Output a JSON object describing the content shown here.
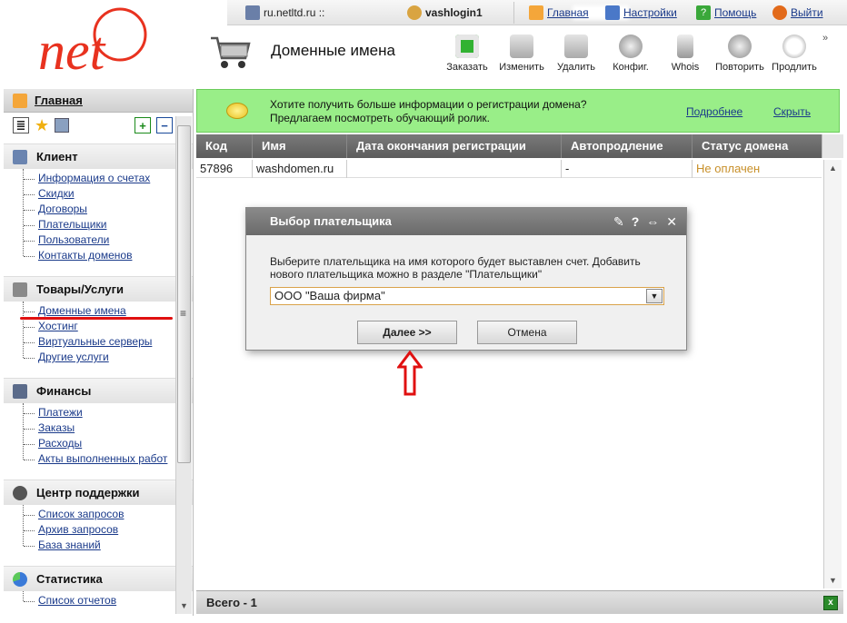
{
  "topbar": {
    "server": "ru.netltd.ru ::",
    "login": "vashlogin1",
    "home": "Главная",
    "settings": "Настройки",
    "help": "Помощь",
    "logout": "Выйти"
  },
  "header": {
    "title": "Доменные имена",
    "logo_text": "net",
    "tools": [
      "Заказать",
      "Изменить",
      "Удалить",
      "Конфиг.",
      "Whois",
      "Повторить",
      "Продлить"
    ],
    "more": "»"
  },
  "sidebar": {
    "main": "Главная",
    "sections": [
      {
        "title": "Клиент",
        "items": [
          "Информация о счетах",
          "Скидки",
          "Договоры",
          "Плательщики",
          "Пользователи",
          "Контакты доменов"
        ]
      },
      {
        "title": "Товары/Услуги",
        "items": [
          "Доменные имена",
          "Хостинг",
          "Виртуальные серверы",
          "Другие услуги"
        ]
      },
      {
        "title": "Финансы",
        "items": [
          "Платежи",
          "Заказы",
          "Расходы",
          "Акты выполненных работ"
        ]
      },
      {
        "title": "Центр поддержки",
        "items": [
          "Список запросов",
          "Архив запросов",
          "База знаний"
        ]
      },
      {
        "title": "Статистика",
        "items": [
          "Список отчетов"
        ]
      }
    ]
  },
  "banner": {
    "line1": "Хотите получить больше информации о регистрации домена?",
    "line2": "Предлагаем посмотреть обучающий ролик.",
    "more_link": "Подробнее",
    "hide_link": "Скрыть"
  },
  "grid": {
    "columns": [
      "Код",
      "Имя",
      "Дата окончания регистрации",
      "Автопродление",
      "Статус домена"
    ],
    "rows": [
      {
        "id": "57896",
        "name": "washdomen.ru",
        "expire": "",
        "autorenew": "-",
        "status": "Не оплачен"
      }
    ],
    "footer": "Всего - 1"
  },
  "dialog": {
    "title": "Выбор плательщика",
    "text": "Выберите плательщика на имя которого будет выставлен счет. Добавить нового плательщика можно в разделе \"Плательщики\"",
    "selected": "ООО \"Ваша фирма\"",
    "next": "Далее >>",
    "cancel": "Отмена"
  },
  "colors": {
    "logo_red": "#e8321f",
    "banner_green": "#99ee88",
    "status_unpaid": "#c8902a",
    "highlight_red": "#e01010"
  }
}
